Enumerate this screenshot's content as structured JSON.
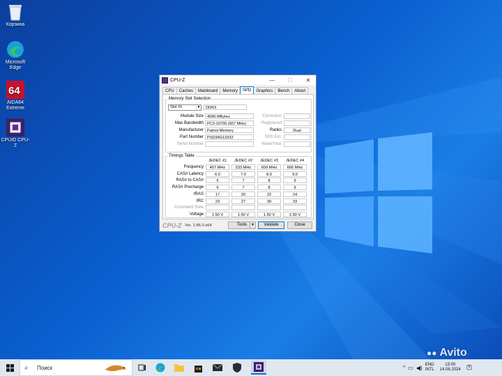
{
  "desktop": {
    "icons": [
      {
        "label": "Корзина",
        "icon": "recycle-bin-icon"
      },
      {
        "label": "Microsoft Edge",
        "icon": "edge-icon"
      },
      {
        "label": "AIDA64 Extreme",
        "icon": "aida64-icon"
      },
      {
        "label": "CPUID CPU-Z",
        "icon": "cpuz-icon"
      }
    ]
  },
  "window": {
    "title": "CPU-Z",
    "tabs": [
      "CPU",
      "Caches",
      "Mainboard",
      "Memory",
      "SPD",
      "Graphics",
      "Bench",
      "About"
    ],
    "active_tab": "SPD",
    "slot_group_title": "Memory Slot Selection",
    "slot_select": "Slot #1",
    "memory_type": "DDR3",
    "left_fields": [
      {
        "label": "Module Size",
        "value": "4096 MBytes"
      },
      {
        "label": "Max Bandwidth",
        "value": "PC3-10700 (667 MHz)"
      },
      {
        "label": "Manufacturer",
        "value": "Patriot Memory"
      },
      {
        "label": "Part Number",
        "value": "PSD34G13332"
      },
      {
        "label": "Serial Number",
        "value": ""
      }
    ],
    "right_fields": [
      {
        "label": "Correction",
        "value": ""
      },
      {
        "label": "Registered",
        "value": ""
      },
      {
        "label": "Ranks",
        "value": "Dual"
      },
      {
        "label": "SPD Ext.",
        "value": ""
      },
      {
        "label": "Week/Year",
        "value": ""
      }
    ],
    "timings_title": "Timings Table",
    "timing_headers": [
      "JEDEC #1",
      "JEDEC #2",
      "JEDEC #3",
      "JEDEC #4"
    ],
    "timing_rows": [
      {
        "label": "Frequency",
        "values": [
          "457 MHz",
          "533 MHz",
          "609 MHz",
          "666 MHz"
        ]
      },
      {
        "label": "CAS# Latency",
        "values": [
          "6.0",
          "7.0",
          "8.0",
          "9.0"
        ]
      },
      {
        "label": "RAS# to CAS#",
        "values": [
          "6",
          "7",
          "8",
          "9"
        ]
      },
      {
        "label": "RAS# Precharge",
        "values": [
          "6",
          "7",
          "8",
          "9"
        ]
      },
      {
        "label": "tRAS",
        "values": [
          "17",
          "20",
          "22",
          "24"
        ]
      },
      {
        "label": "tRC",
        "values": [
          "23",
          "27",
          "30",
          "33"
        ]
      },
      {
        "label": "Command Rate",
        "values": [
          "",
          "",
          "",
          ""
        ]
      },
      {
        "label": "Voltage",
        "values": [
          "1.50 V",
          "1.50 V",
          "1.50 V",
          "1.50 V"
        ]
      }
    ],
    "brand": "CPU-Z",
    "version": "Ver. 1.86.0.x64",
    "tools_label": "Tools",
    "validate_label": "Validate",
    "close_label": "Close"
  },
  "taskbar": {
    "search_placeholder": "Поиск",
    "lang_line1": "ENG",
    "lang_line2": "INTL",
    "time": "13:00",
    "date": "14.08.2024",
    "notification_count": "6"
  },
  "watermark": "Avito",
  "colors": {
    "accent": "#0078d7",
    "cpuz_purple": "#5a2f8d"
  }
}
